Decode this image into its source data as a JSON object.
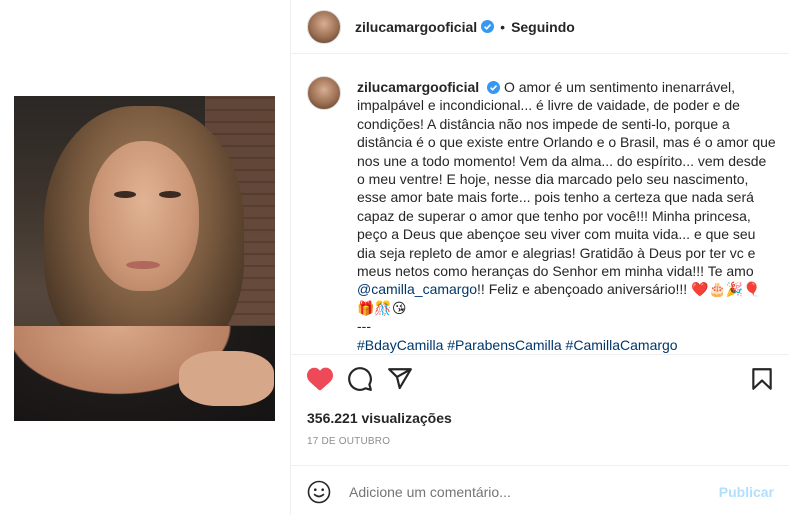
{
  "post": {
    "username": "zilucamargooficial",
    "follow_separator": "•",
    "follow_status": "Seguindo",
    "caption_text": "O amor é um sentimento inenarrável, impalpável e incondicional... é livre de vaidade, de poder e de condições! A distância não nos impede de senti-lo, porque a distância é o que existe entre Orlando e o Brasil, mas é o amor que nos une a todo momento! Vem da alma... do espírito... vem desde o meu ventre! E hoje, nesse dia marcado pelo seu nascimento, esse amor bate mais forte... pois tenho a certeza que nada será capaz de superar o amor que tenho por você!!! Minha princesa, peço a Deus que abençoe seu viver com muita vida... e que seu dia seja repleto de amor e alegrias! Gratidão à Deus por ter vc e meus netos como heranças do Senhor em minha vida!!! Te amo",
    "mention": "@camilla_camargo",
    "caption_after_mention": "!! Feliz e abençoado aniversário!!! ❤️🎂🎉🎈🎁🎊😘",
    "separator": "---",
    "hashtags": "#BdayCamilla #ParabensCamilla #CamillaCamargo #FelizAniversario #Parabens #DeusAbençoe #AmorMaior #AmorIncondicional",
    "views": "356.221 visualizações",
    "date": "17 DE OUTUBRO"
  },
  "comment": {
    "placeholder": "Adicione um comentário...",
    "post_label": "Publicar"
  },
  "icons": {
    "like": "heart-filled",
    "comment": "comment-bubble",
    "share": "paper-plane",
    "save": "bookmark",
    "emoji": "smiley"
  },
  "colors": {
    "like_red": "#ed4956",
    "link_blue": "#00376b",
    "verified_blue": "#3897f0",
    "publish_disabled": "#b2dffc"
  }
}
